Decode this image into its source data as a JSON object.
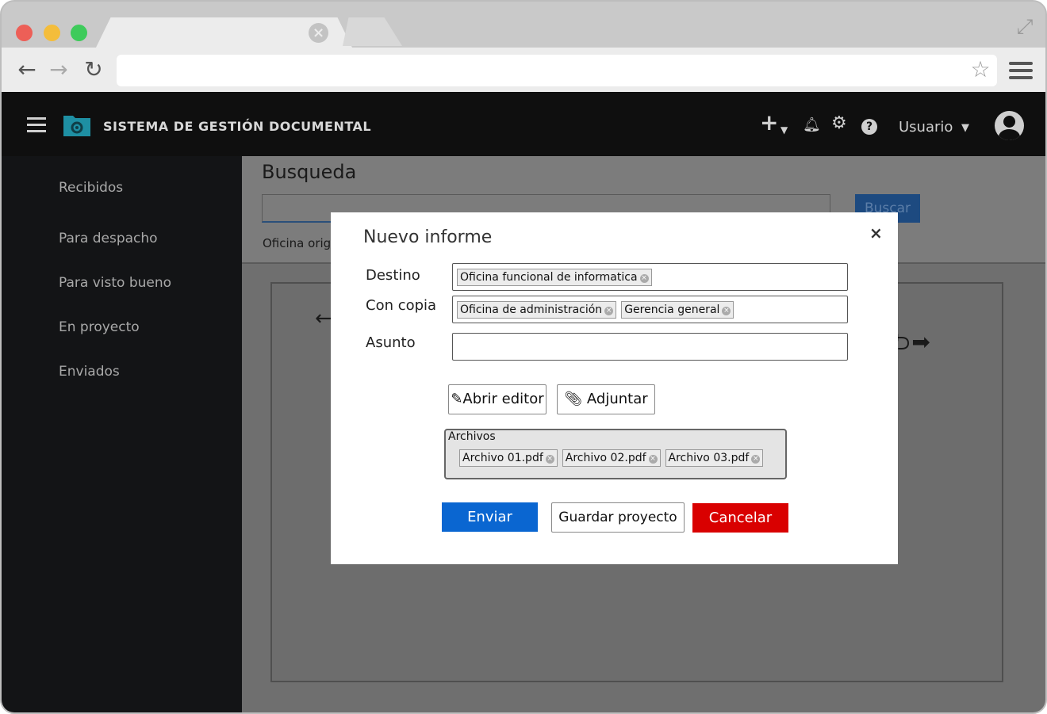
{
  "app": {
    "title": "SISTEMA DE GESTIÓN DOCUMENTAL",
    "user_label": "Usuario"
  },
  "sidebar": {
    "items": [
      {
        "label": "Recibidos"
      },
      {
        "label": "Para despacho"
      },
      {
        "label": "Para visto bueno"
      },
      {
        "label": "En proyecto"
      },
      {
        "label": "Enviados"
      }
    ]
  },
  "main": {
    "page_title": "Busqueda",
    "search_button": "Buscar",
    "office_filter": "Oficina orig"
  },
  "modal": {
    "title": "Nuevo informe",
    "close": "×",
    "fields": {
      "destino_label": "Destino",
      "con_copia_label": "Con copia",
      "asunto_label": "Asunto",
      "asunto_value": ""
    },
    "destino_tags": [
      "Oficina funcional de informatica"
    ],
    "con_copia_tags": [
      "Oficina de administración",
      "Gerencia general"
    ],
    "open_editor": "Abrir editor",
    "attach": "Adjuntar",
    "files_label": "Archivos",
    "files": [
      "Archivo 01.pdf",
      "Archivo 02.pdf",
      "Archivo 03.pdf"
    ],
    "send": "Enviar",
    "save_project": "Guardar proyecto",
    "cancel": "Cancelar"
  },
  "colors": {
    "send": "#0a66d1",
    "cancel": "#d90000",
    "header": "#0f0f0f",
    "sidebar": "#131416"
  }
}
